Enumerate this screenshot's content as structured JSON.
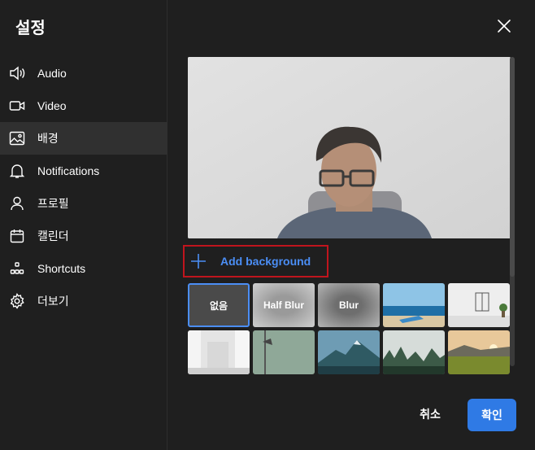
{
  "sidebar": {
    "title": "설정",
    "items": [
      {
        "label": "Audio",
        "icon": "speaker-icon"
      },
      {
        "label": "Video",
        "icon": "video-camera-icon"
      },
      {
        "label": "배경",
        "icon": "image-icon",
        "active": true
      },
      {
        "label": "Notifications",
        "icon": "bell-icon"
      },
      {
        "label": "프로필",
        "icon": "person-icon"
      },
      {
        "label": "캘린더",
        "icon": "calendar-icon"
      },
      {
        "label": "Shortcuts",
        "icon": "shortcuts-icon"
      },
      {
        "label": "더보기",
        "icon": "gear-icon"
      }
    ]
  },
  "main": {
    "add_background_label": "Add background",
    "backgrounds": [
      {
        "label": "없음",
        "selected": true
      },
      {
        "label": "Half Blur"
      },
      {
        "label": "Blur"
      },
      {
        "label": ""
      },
      {
        "label": ""
      },
      {
        "label": ""
      },
      {
        "label": ""
      },
      {
        "label": ""
      },
      {
        "label": ""
      },
      {
        "label": ""
      }
    ]
  },
  "footer": {
    "cancel_label": "취소",
    "ok_label": "확인"
  },
  "colors": {
    "accent": "#2f7ae5",
    "link": "#4b8ef5",
    "highlight_border": "#c0151d",
    "background": "#1f1f1f"
  }
}
